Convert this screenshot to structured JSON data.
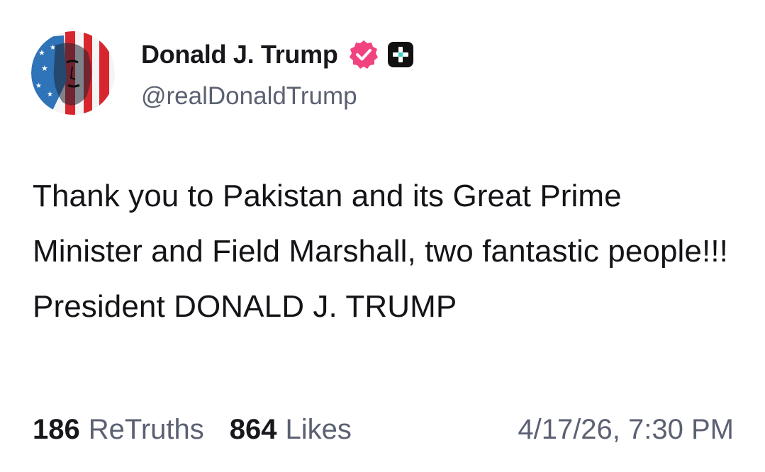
{
  "author": {
    "display_name": "Donald J. Trump",
    "handle": "@realDonaldTrump",
    "verified_icon": "verified-badge-icon",
    "plus_icon": "plus-badge-icon"
  },
  "post": {
    "text": "Thank you to Pakistan and its Great Prime Minister and Field Marshall, two fantastic people!!! President DONALD J. TRUMP"
  },
  "stats": {
    "retruths_count": "186",
    "retruths_label": "ReTruths",
    "likes_count": "864",
    "likes_label": "Likes"
  },
  "timestamp": "4/17/26, 7:30 PM",
  "colors": {
    "verified_badge": "#f0437f",
    "plus_badge": "#111111",
    "plus_sign": "#3bd1c9",
    "secondary_text": "#5b6172",
    "primary_text": "#141418"
  }
}
